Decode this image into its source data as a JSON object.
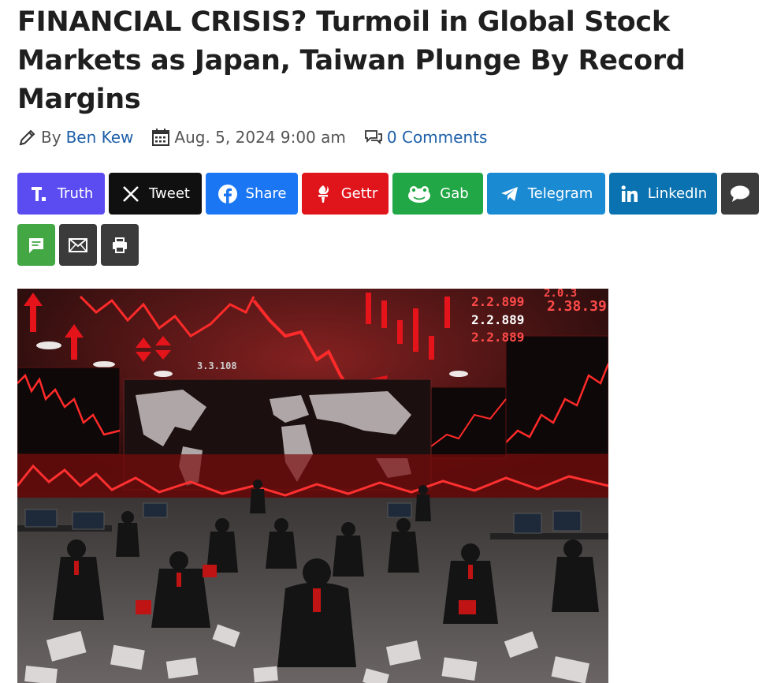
{
  "article": {
    "headline": "FINANCIAL CRISIS? Turmoil in Global Stock Markets as Japan, Taiwan Plunge By Record Margins",
    "by_label": "By",
    "author": "Ben Kew",
    "date": "Aug. 5, 2024 9:00 am",
    "comments": "0 Comments"
  },
  "share_buttons": [
    {
      "label": "Truth",
      "icon": "truth-social-icon",
      "color": "#5a4cf0"
    },
    {
      "label": "Tweet",
      "icon": "x-icon",
      "color": "#101010"
    },
    {
      "label": "Share",
      "icon": "facebook-icon",
      "color": "#1a76f2"
    },
    {
      "label": "Gettr",
      "icon": "gettr-icon",
      "color": "#e0141b"
    },
    {
      "label": "Gab",
      "icon": "gab-frog-icon",
      "color": "#22a746"
    },
    {
      "label": "Telegram",
      "icon": "telegram-icon",
      "color": "#1a8ad2"
    },
    {
      "label": "LinkedIn",
      "icon": "linkedin-icon",
      "color": "#0a72b0"
    },
    {
      "label": "",
      "icon": "comment-bubble-icon",
      "color": "#3b3b3b"
    }
  ],
  "share_buttons_row2": [
    {
      "label": "",
      "icon": "sms-icon",
      "color": "#43a744"
    },
    {
      "label": "",
      "icon": "email-icon",
      "color": "#3b3b3b"
    },
    {
      "label": "",
      "icon": "print-icon",
      "color": "#3b3b3b"
    }
  ],
  "hero_image": {
    "screen_numbers": [
      "3.3.108",
      "2.2.899",
      "2.2.889",
      "2.2.889",
      "2.38.39",
      "2.0.3"
    ],
    "palette": {
      "bg": "#1a0b0b",
      "red": "#e5141b",
      "glow": "#ffffff"
    }
  }
}
